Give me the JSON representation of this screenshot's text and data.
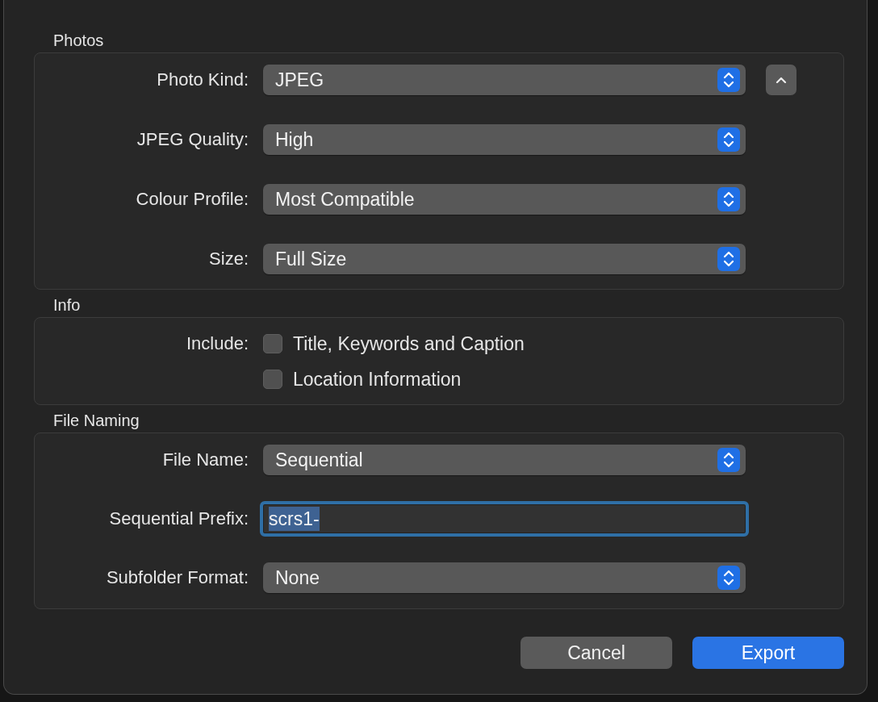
{
  "sections": [
    {
      "title": "Photos",
      "collapse_button": true,
      "rows": [
        {
          "kind": "popup",
          "label": "Photo Kind:",
          "value": "JPEG"
        },
        {
          "kind": "popup",
          "label": "JPEG Quality:",
          "value": "High"
        },
        {
          "kind": "popup",
          "label": "Colour Profile:",
          "value": "Most Compatible"
        },
        {
          "kind": "popup",
          "label": "Size:",
          "value": "Full Size"
        }
      ]
    },
    {
      "title": "Info",
      "collapse_button": false,
      "rows": [
        {
          "kind": "checkboxes",
          "label": "Include:",
          "options": [
            {
              "label": "Title, Keywords and Caption",
              "checked": false
            },
            {
              "label": "Location Information",
              "checked": false
            }
          ]
        }
      ]
    },
    {
      "title": "File Naming",
      "collapse_button": false,
      "rows": [
        {
          "kind": "popup",
          "label": "File Name:",
          "value": "Sequential"
        },
        {
          "kind": "text",
          "label": "Sequential Prefix:",
          "value": "scrs1-",
          "focused": true
        },
        {
          "kind": "popup",
          "label": "Subfolder Format:",
          "value": "None"
        }
      ]
    }
  ],
  "buttons": [
    {
      "label": "Cancel",
      "kind": "cancel"
    },
    {
      "label": "Export",
      "kind": "default"
    }
  ]
}
